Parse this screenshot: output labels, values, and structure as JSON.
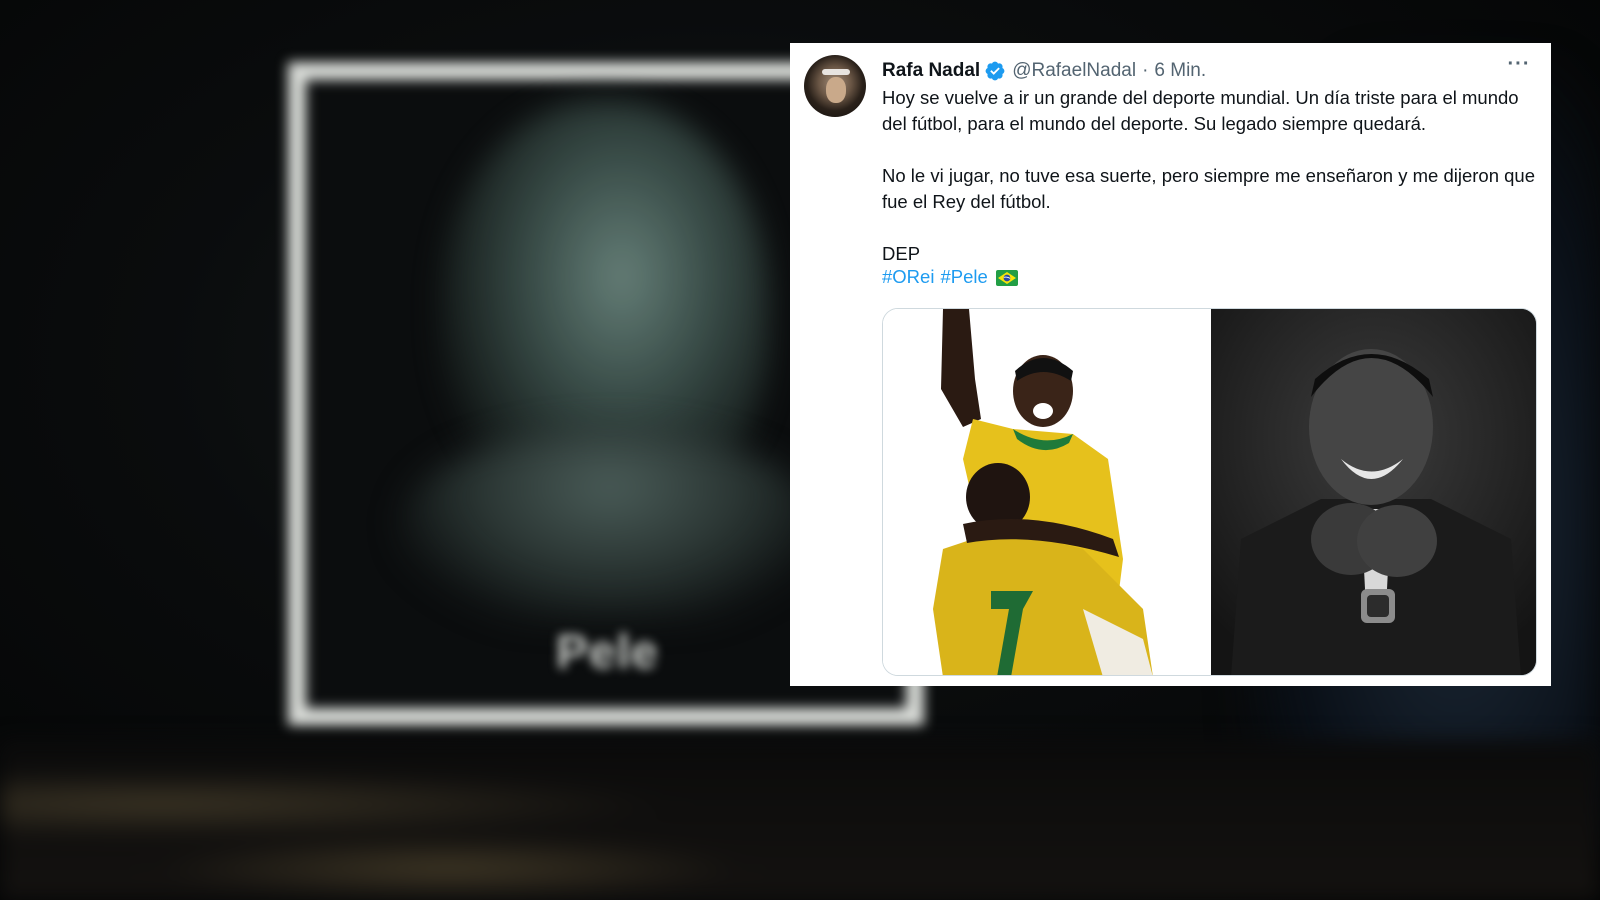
{
  "tweet": {
    "display_name": "Rafa Nadal",
    "handle": "@RafaelNadal",
    "separator": "·",
    "time": "6 Min.",
    "more_label": "···",
    "paragraph_1": "Hoy se vuelve a ir un grande del deporte mundial. Un día triste para el mundo del fútbol, para el mundo del deporte. Su legado siempre quedará.",
    "paragraph_2": "No le vi jugar, no tuve esa suerte, pero siempre me enseñaron y me dijeron que fue el Rey del fútbol.",
    "paragraph_3": "DEP",
    "hashtags": [
      "#ORei",
      "#Pele"
    ],
    "flag_icon": "brazil-flag-icon",
    "media": [
      {
        "icon": "photo-pele-celebrating-in-yellow-jersey"
      },
      {
        "icon": "photo-pele-black-and-white-portrait"
      }
    ]
  },
  "background": {
    "blurred_caption": "Pele"
  },
  "colors": {
    "link": "#1d9bf0",
    "verified": "#1d9bf0",
    "text": "#0f1419",
    "secondary": "#536471"
  }
}
